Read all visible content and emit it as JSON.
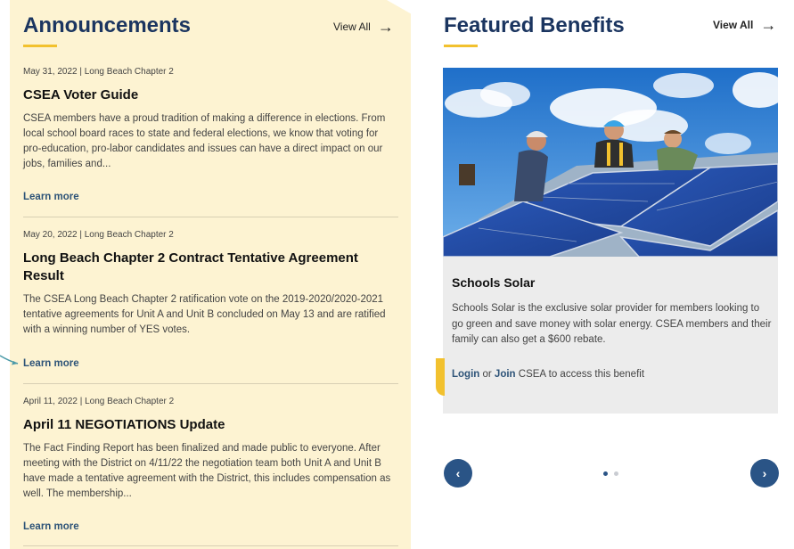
{
  "announcements": {
    "title": "Announcements",
    "view_all": "View All",
    "items": [
      {
        "meta": "May 31, 2022  |  Long Beach Chapter 2",
        "title": "CSEA Voter Guide",
        "body": "CSEA members have a proud tradition of making a difference in elections. From local school board races to state and federal elections, we know that voting for pro-education, pro-labor candidates and issues can have a direct impact on our jobs, families and...",
        "link": "Learn more"
      },
      {
        "meta": "May 20, 2022  |  Long Beach Chapter 2",
        "title": "Long Beach Chapter 2 Contract Tentative Agreement Result",
        "body": "The CSEA Long Beach Chapter 2 ratification vote on the 2019-2020/2020-2021 tentative agreements for Unit A and Unit B concluded on May 13 and are ratified with a winning number of YES votes.",
        "link": "Learn more"
      },
      {
        "meta": "April 11, 2022  |  Long Beach Chapter 2",
        "title": "April 11 NEGOTIATIONS Update",
        "body": "The Fact Finding Report has been finalized and made public to everyone. After meeting with the District on 4/11/22 the negotiation team both Unit A and Unit B have made a tentative agreement with the District, this includes compensation as well. The membership...",
        "link": "Learn more"
      }
    ]
  },
  "featured": {
    "title": "Featured Benefits",
    "view_all": "View All",
    "card": {
      "title": "Schools Solar",
      "description": "Schools Solar is the exclusive solar provider for members looking to go green and save money with solar energy. CSEA members and their family can also get a $600 rebate.",
      "login": "Login",
      "or": " or ",
      "join": "Join",
      "access_suffix": " CSEA to access this benefit"
    },
    "carousel": {
      "prev_icon": "chevron-left-icon",
      "next_icon": "chevron-right-icon",
      "total_slides": 2,
      "active_slide": 1
    }
  },
  "colors": {
    "panel_bg": "#fdf3d2",
    "heading": "#1b3560",
    "accent": "#f2c12e",
    "link": "#2d5378",
    "button": "#2a5486"
  }
}
